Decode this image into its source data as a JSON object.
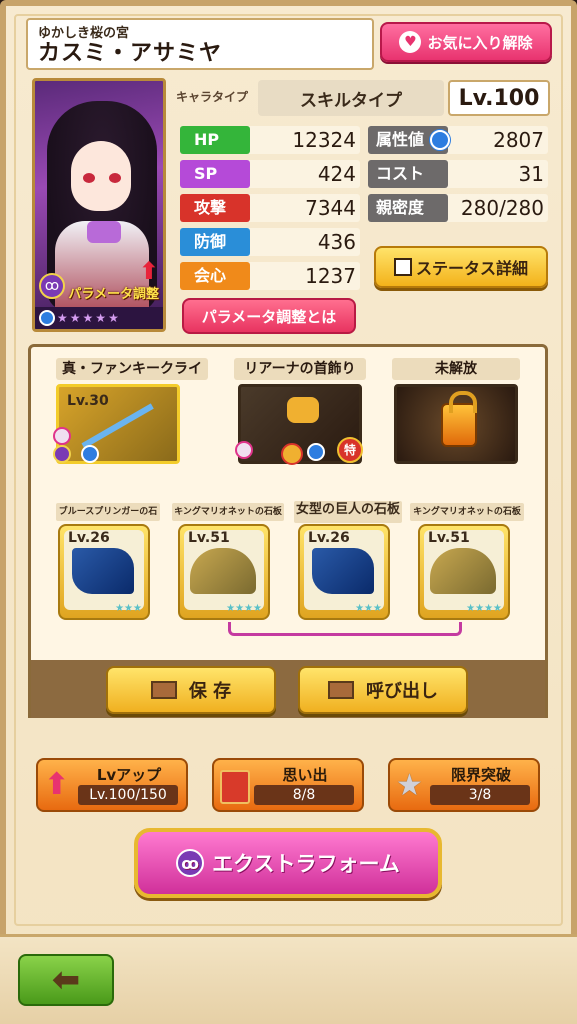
{
  "header": {
    "subtitle": "ゆかしき桜の宮",
    "name": "カスミ・アサミヤ",
    "favorite_label": "お気に入り解除"
  },
  "portrait": {
    "param_label": "パラメータ調整",
    "rarity_stars": 5
  },
  "type_row": {
    "label": "キャラタイプ",
    "value": "スキルタイプ",
    "level": "Lv.100"
  },
  "stats_left": [
    {
      "label": "HP",
      "value": "12324",
      "color": "#34b53a"
    },
    {
      "label": "SP",
      "value": "424",
      "color": "#b54ad8"
    },
    {
      "label": "攻撃",
      "value": "7344",
      "color": "#d8332a"
    },
    {
      "label": "防御",
      "value": "436",
      "color": "#2a8ed8"
    },
    {
      "label": "会心",
      "value": "1237",
      "color": "#f08a1a"
    }
  ],
  "stats_right": [
    {
      "label": "属性値",
      "value": "2807"
    },
    {
      "label": "コスト",
      "value": "31"
    },
    {
      "label": "親密度",
      "value": "280/280"
    }
  ],
  "buttons": {
    "status_detail": "ステータス詳細",
    "param_about": "パラメータ調整とは",
    "save": "保 存",
    "recall": "呼び出し",
    "extra_form": "エクストラフォーム",
    "special_badge": "特"
  },
  "equipment": [
    {
      "title": "真・ファンキークライ",
      "level": "Lv.30"
    },
    {
      "title": "リアーナの首飾り",
      "level": ""
    },
    {
      "title": "未解放",
      "level": ""
    }
  ],
  "stones": [
    {
      "title": "ブルースプリンガーの石板",
      "level": "Lv.26",
      "stars": "★★★"
    },
    {
      "title": "キングマリオネットの石板",
      "level": "Lv.51",
      "stars": "★★★★"
    },
    {
      "title": "女型の巨人の石板",
      "level": "Lv.26",
      "stars": "★★★"
    },
    {
      "title": "キングマリオネットの石板",
      "level": "Lv.51",
      "stars": "★★★★"
    }
  ],
  "growth": [
    {
      "title": "Lvアップ",
      "value": "Lv.100/150"
    },
    {
      "title": "思い出",
      "value": "8/8"
    },
    {
      "title": "限界突破",
      "value": "3/8"
    }
  ]
}
